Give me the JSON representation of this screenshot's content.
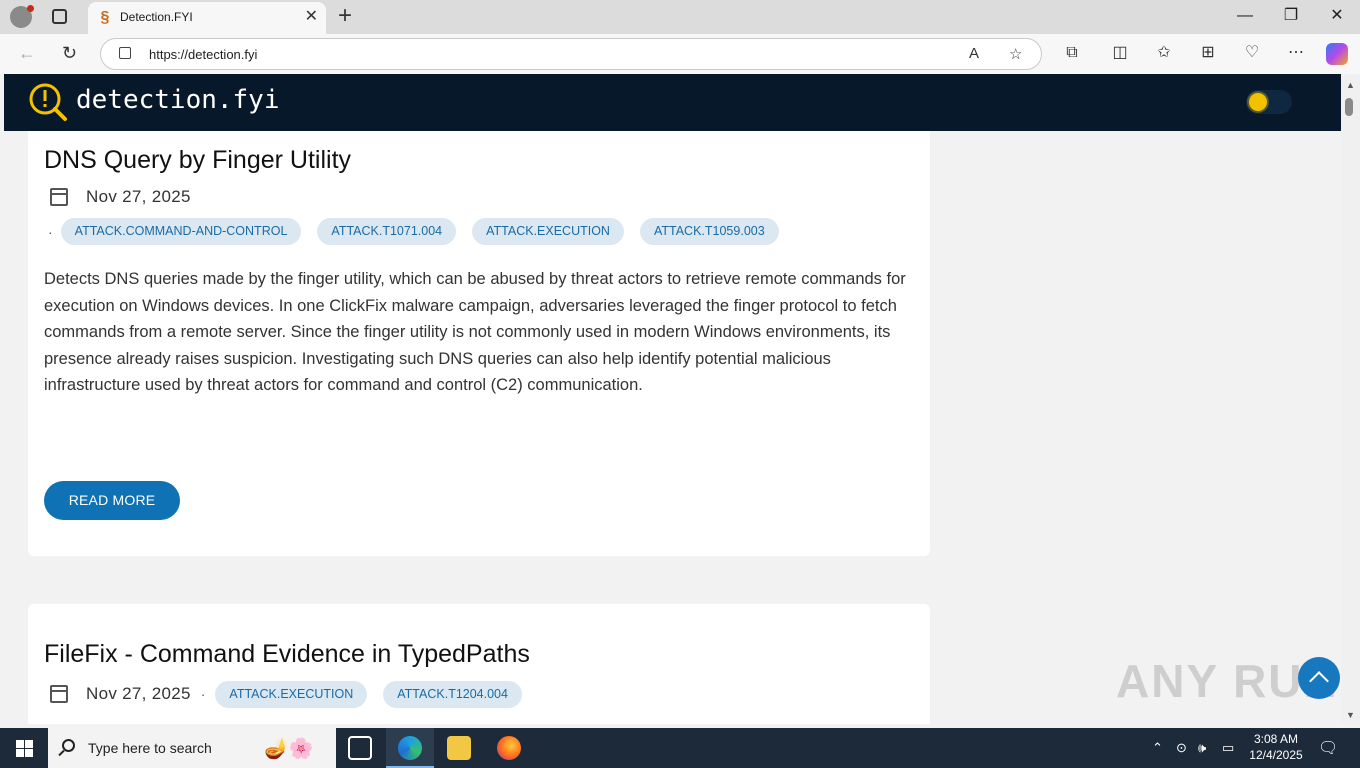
{
  "browser": {
    "tab_title": "Detection.FYI",
    "url": "https://detection.fyi"
  },
  "site": {
    "logo_text": "detection.fyi"
  },
  "posts": [
    {
      "title": "DNS Query by Finger Utility",
      "date": "Nov 27, 2025",
      "tags": [
        "ATTACK.COMMAND-AND-CONTROL",
        "ATTACK.T1071.004",
        "ATTACK.EXECUTION",
        "ATTACK.T1059.003"
      ],
      "description": "Detects DNS queries made by the finger utility, which can be abused by threat actors to retrieve remote commands for execution on Windows devices. In one ClickFix malware campaign, adversaries leveraged the finger protocol to fetch commands from a remote server. Since the finger utility is not commonly used in modern Windows environments, its presence already raises suspicion. Investigating such DNS queries can also help identify potential malicious infrastructure used by threat actors for command and control (C2) communication.",
      "read_more_label": "READ MORE"
    },
    {
      "title": "FileFix - Command Evidence in TypedPaths",
      "date": "Nov 27, 2025",
      "tags": [
        "ATTACK.EXECUTION",
        "ATTACK.T1204.004"
      ]
    }
  ],
  "watermark": "ANY RUN",
  "taskbar": {
    "search_placeholder": "Type here to search",
    "time": "3:08 AM",
    "date": "12/4/2025"
  },
  "colors": {
    "header_bg": "#08182b",
    "tag_bg": "#dbe8f1",
    "tag_text": "#1a6aa6",
    "button_bg": "#0f72b5"
  }
}
